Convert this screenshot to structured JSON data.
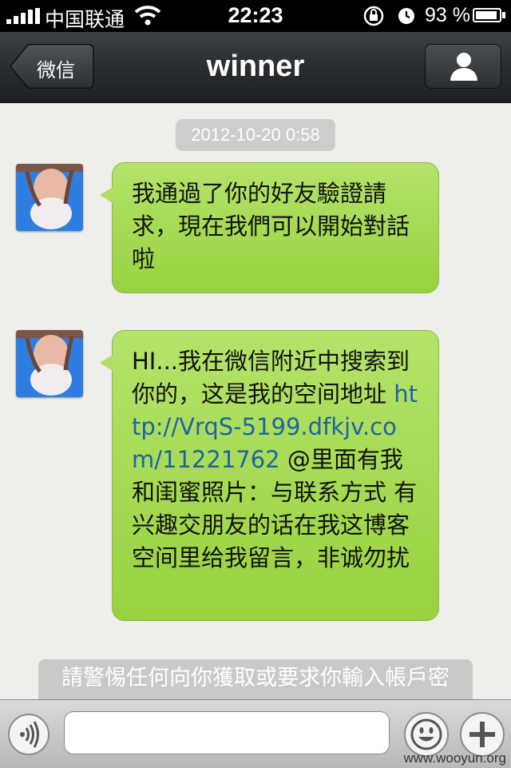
{
  "status_bar": {
    "carrier": "中国联通",
    "time": "22:23",
    "battery_percent": "93 %",
    "battery_level": 0.93,
    "icons": [
      "signal-icon",
      "wifi-icon",
      "rotation-lock-icon",
      "alarm-icon",
      "battery-icon"
    ]
  },
  "nav": {
    "back_label": "微信",
    "title": "winner",
    "profile_icon": "person-icon"
  },
  "chat": {
    "timestamp": "2012-10-20 0:58",
    "messages": [
      {
        "text": "我通過了你的好友驗證請求，現在我們可以開始對話啦"
      },
      {
        "text_before": " HI...我在微信附近中搜索到你的，这是我的空间地址 ",
        "link": "http://VrqS-5199.dfkjv.com/11221762",
        "text_after": " @里面有我和闺蜜照片：与联系方式  有兴趣交朋友的话在我这博客空间里给我留言，非诚勿扰"
      }
    ],
    "warning": "請警惕任何向你獲取或要求你輸入帳戶密"
  },
  "input_bar": {
    "value": "",
    "icons": [
      "voice-icon",
      "emoji-icon",
      "plus-icon"
    ]
  },
  "watermark": "www.wooyun.org",
  "colors": {
    "bubble_green": "#a5da52",
    "link": "#1d63a6",
    "nav_dark": "#2a2d30"
  }
}
